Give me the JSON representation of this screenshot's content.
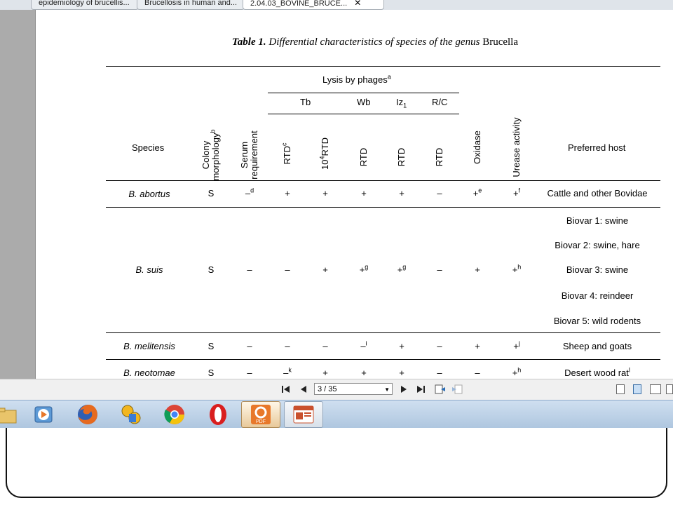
{
  "tabs": [
    {
      "label": "epidemiology of brucellis..."
    },
    {
      "label": "Brucellosis in human and..."
    },
    {
      "label": "2.04.03_BOVINE_BRUCE...",
      "active": true
    }
  ],
  "table": {
    "title_bold": "Table 1.",
    "title_italic": "Differential characteristics of species of the genus",
    "title_genus": "Brucella",
    "headers": {
      "species": "Species",
      "colony_line1": "Colony",
      "colony_line2": "morphology",
      "colony_sup": "b",
      "serum_line1": "Serum",
      "serum_line2": "requirement",
      "lysis": "Lysis by phages",
      "lysis_sup": "a",
      "tb": "Tb",
      "wb": "Wb",
      "iz": "Iz",
      "iz_sub": "1",
      "rc": "R/C",
      "rtd_c": "RTD",
      "rtd_c_sup": "c",
      "rtd_4_pre": "10",
      "rtd_4_sup": "4",
      "rtd_4_post": "RTD",
      "rtd": "RTD",
      "oxidase": "Oxidase",
      "urease": "Urease activity",
      "host": "Preferred host"
    },
    "rows": [
      {
        "species": "B. abortus",
        "cells": [
          "S",
          "–",
          "+",
          "+",
          "+",
          "+",
          "–",
          "+",
          "+"
        ],
        "sups": [
          "",
          "d",
          "",
          "",
          "",
          "",
          "",
          "e",
          "f"
        ],
        "hosts": [
          "Cattle and other Bovidae"
        ]
      },
      {
        "species": "B. suis",
        "cells": [
          "S",
          "–",
          "–",
          "+",
          "+",
          "+",
          "–",
          "+",
          "+"
        ],
        "sups": [
          "",
          "",
          "",
          "",
          "g",
          "g",
          "",
          "",
          "h"
        ],
        "hosts": [
          "Biovar 1: swine",
          "Biovar 2: swine, hare",
          "Biovar 3: swine",
          "Biovar 4: reindeer",
          "Biovar 5: wild rodents"
        ]
      },
      {
        "species": "B. melitensis",
        "cells": [
          "S",
          "–",
          "–",
          "–",
          "–",
          "+",
          "–",
          "+",
          "+"
        ],
        "sups": [
          "",
          "",
          "",
          "",
          "i",
          "",
          "",
          "",
          "j"
        ],
        "hosts": [
          "Sheep and goats"
        ]
      },
      {
        "species": "B. neotomae",
        "cells": [
          "S",
          "–",
          "–",
          "+",
          "+",
          "+",
          "–",
          "–",
          "+"
        ],
        "sups": [
          "",
          "",
          "k",
          "",
          "",
          "",
          "",
          "",
          "h"
        ],
        "hosts": [
          "Desert wood rat"
        ],
        "host_sup": "l"
      }
    ]
  },
  "pdf_toolbar": {
    "page_indicator": "3 / 35"
  },
  "taskbar": {
    "apps": [
      {
        "name": "file-explorer-icon"
      },
      {
        "name": "media-player-icon"
      },
      {
        "name": "firefox-icon"
      },
      {
        "name": "security-tool-icon"
      },
      {
        "name": "chrome-icon"
      },
      {
        "name": "opera-icon"
      },
      {
        "name": "pdf-reader-icon",
        "label": "PDF"
      },
      {
        "name": "powerpoint-icon"
      }
    ]
  }
}
